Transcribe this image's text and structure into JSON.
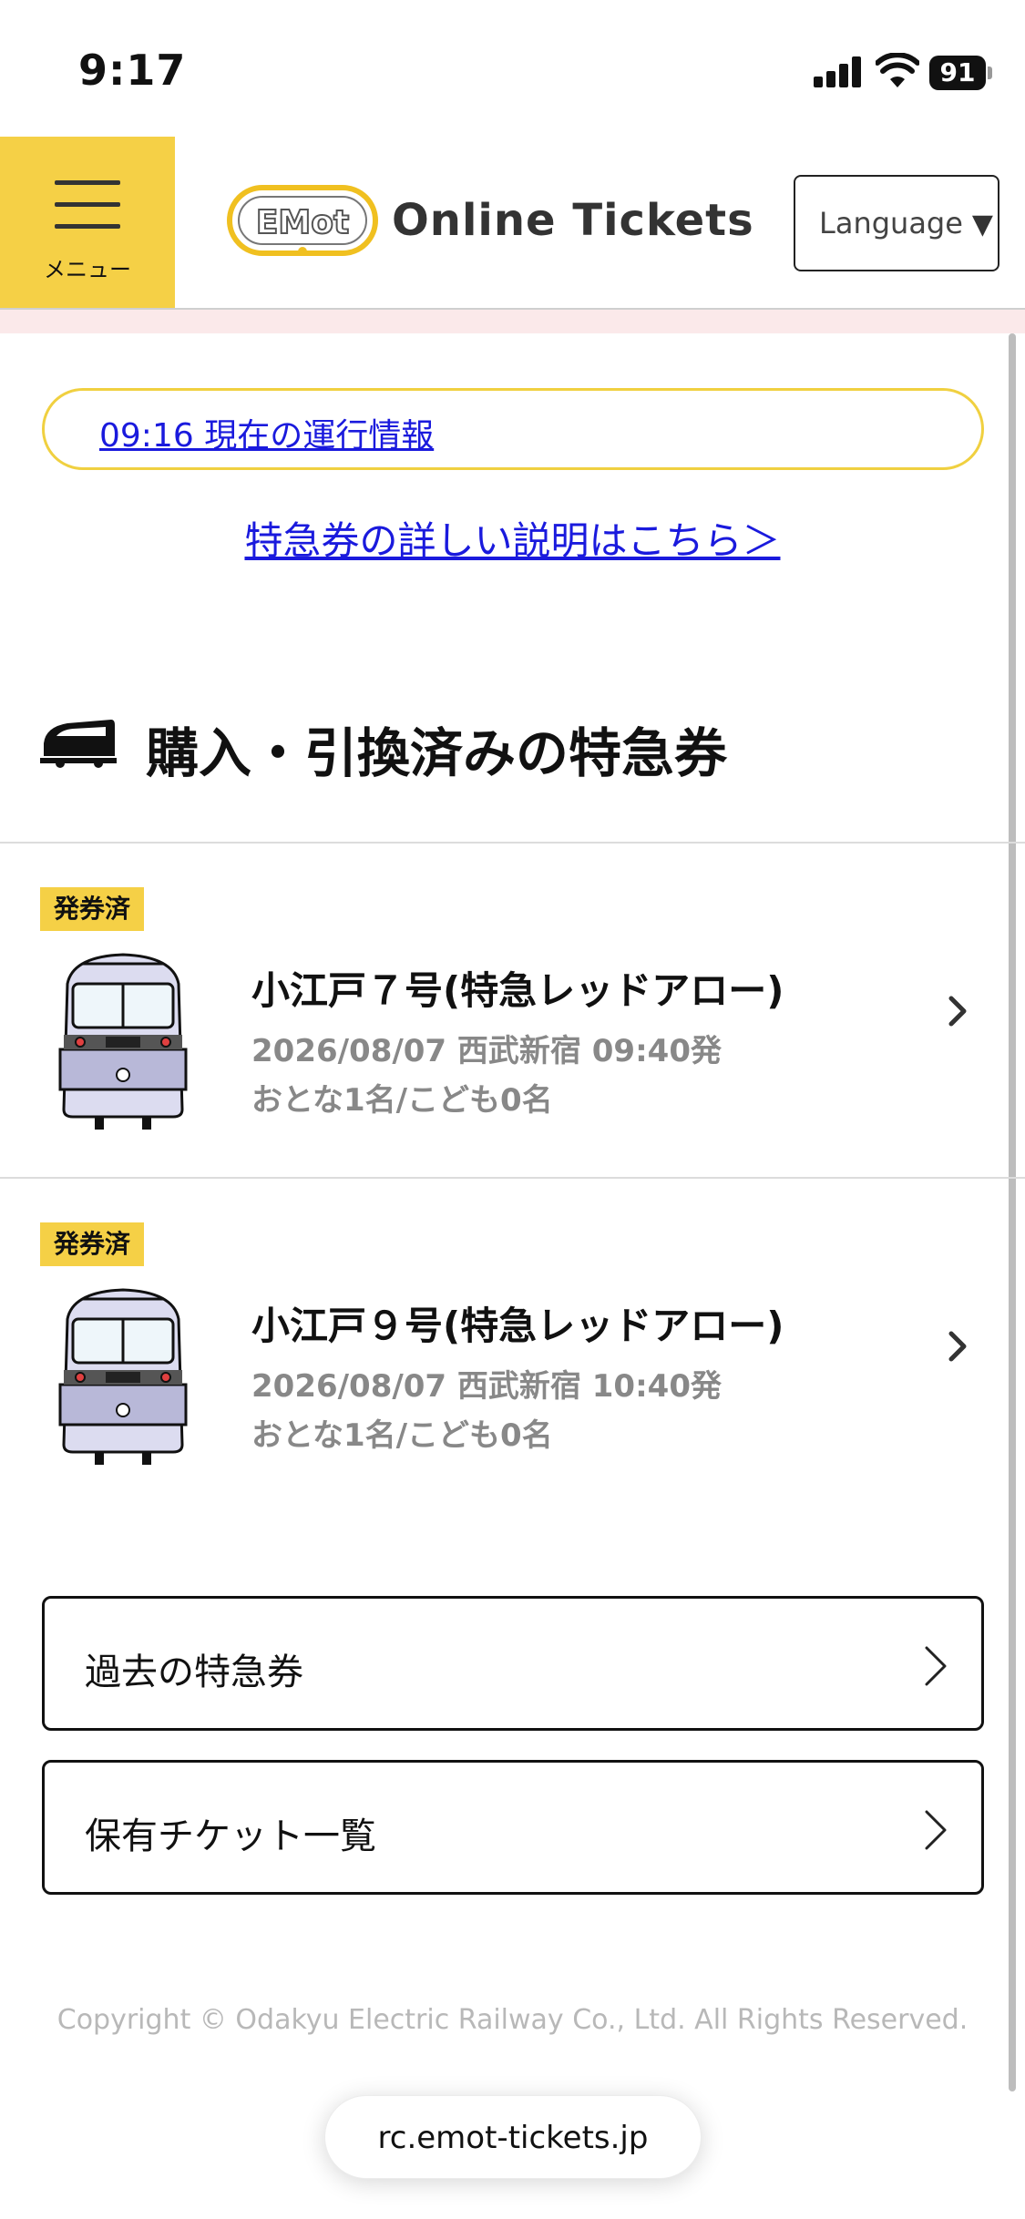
{
  "status_bar": {
    "time": "9:17",
    "battery": "91"
  },
  "header": {
    "menu_label": "メニュー",
    "logo_text": "Online Tickets",
    "logo_mark": "EMot",
    "language_label": "Language",
    "language_arrow": "▼"
  },
  "operation_info": {
    "link_text": "09:16 現在の運行情報"
  },
  "detail_link": "特急券の詳しい説明はこちら＞",
  "section": {
    "title": "購入・引換済みの特急券"
  },
  "tickets": [
    {
      "badge": "発券済",
      "name": "小江戸７号(特急レッドアロー)",
      "date_line": "2026/08/07 西武新宿 09:40発",
      "passengers": "おとな1名/こども0名"
    },
    {
      "badge": "発券済",
      "name": "小江戸９号(特急レッドアロー)",
      "date_line": "2026/08/07 西武新宿 10:40発",
      "passengers": "おとな1名/こども0名"
    }
  ],
  "nav_buttons": [
    {
      "label": "過去の特急券"
    },
    {
      "label": "保有チケット一覧"
    }
  ],
  "footer": {
    "copyright": "Copyright © Odakyu Electric Railway Co., Ltd. All Rights Reserved."
  },
  "browser": {
    "url": "rc.emot-tickets.jp"
  },
  "colors": {
    "accent_yellow": "#f5d046",
    "link_blue": "#1a1add",
    "pink_strip": "#fbe9ea"
  }
}
